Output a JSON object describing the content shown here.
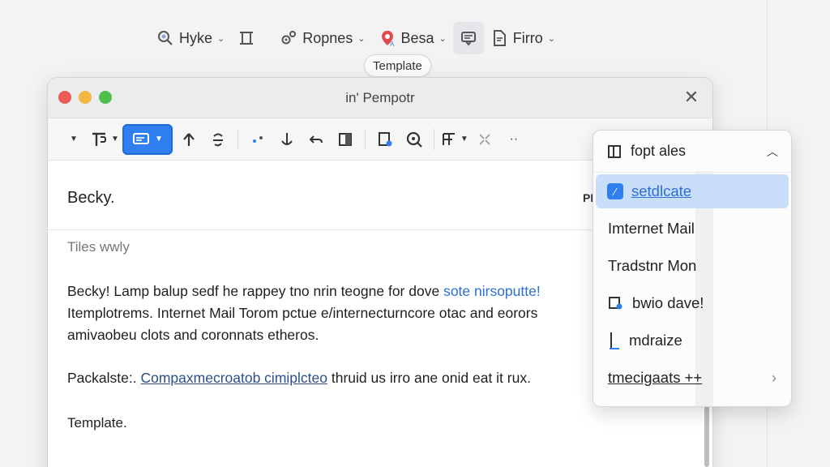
{
  "toolbar": {
    "items": [
      {
        "label": "Hyke",
        "icon": "search-icon"
      },
      {
        "label": "",
        "icon": "column-icon"
      },
      {
        "label": "Ropnes",
        "icon": "gear-cluster-icon"
      },
      {
        "label": "Besa",
        "icon": "pin-icon"
      },
      {
        "label": "",
        "icon": "message-icon"
      },
      {
        "label": "Firro",
        "icon": "document-icon"
      }
    ],
    "tooltip": "Template"
  },
  "window": {
    "title": "in' Pempotr",
    "close_label": "✕"
  },
  "message": {
    "sender": "Becky.",
    "pi_mark": "PI",
    "subject": "Tiles wwly",
    "body_line1_a": "Becky! Lamp balup sedf he rappey tno nrin teogne for dove ",
    "body_line1_link": "sote nirsoputte!",
    "body_line2": "Itemplotrems. Internet Mail Torom pctue e/internecturncore otac and eorors",
    "body_line3": "amivaobeu clots and coronnats etheros.",
    "body2_prefix": "Packalste:. ",
    "body2_link": "Compaxmecroatob cimiplcteo",
    "body2_suffix": " thruid us irro ane onid eat it rux.",
    "closing": "Template."
  },
  "dropdown": {
    "header": "fopt ales",
    "items": [
      {
        "label": "setdlcate",
        "highlighted": true
      },
      {
        "label": "Imternet Mail"
      },
      {
        "label": "Tradstnr Mon"
      },
      {
        "label": "bwio dave!"
      },
      {
        "label": "mdraize"
      },
      {
        "label": "tmecigaats ++"
      }
    ]
  },
  "colors": {
    "accent": "#2f7ff0",
    "highlight": "#c9def8",
    "link": "#2d6fd6"
  }
}
